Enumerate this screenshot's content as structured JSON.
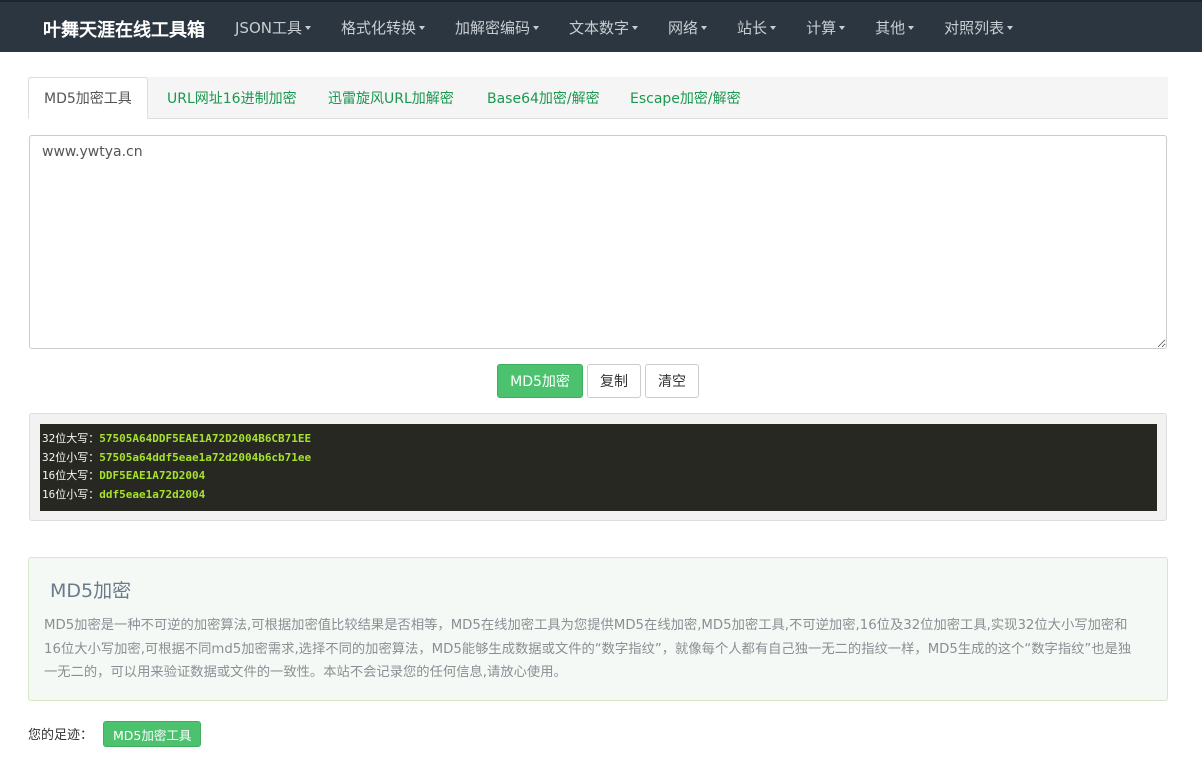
{
  "navbar": {
    "brand": "叶舞天涯在线工具箱",
    "items": [
      {
        "label": "JSON工具"
      },
      {
        "label": "格式化转换"
      },
      {
        "label": "加解密编码"
      },
      {
        "label": "文本数字"
      },
      {
        "label": "网络"
      },
      {
        "label": "站长"
      },
      {
        "label": "计算"
      },
      {
        "label": "其他"
      },
      {
        "label": "对照列表"
      }
    ]
  },
  "tabs": [
    {
      "label": "MD5加密工具",
      "active": true
    },
    {
      "label": "URL网址16进制加密"
    },
    {
      "label": "迅雷旋风URL加解密"
    },
    {
      "label": "Base64加密/解密"
    },
    {
      "label": "Escape加密/解密"
    }
  ],
  "input": {
    "value": "www.ywtya.cn"
  },
  "buttons": {
    "encrypt": "MD5加密",
    "copy": "复制",
    "clear": "清空"
  },
  "results": [
    {
      "label": "32位大写：",
      "value": "57505A64DDF5EAE1A72D2004B6CB71EE"
    },
    {
      "label": "32位小写：",
      "value": "57505a64ddf5eae1a72d2004b6cb71ee"
    },
    {
      "label": "16位大写：",
      "value": "DDF5EAE1A72D2004"
    },
    {
      "label": "16位小写：",
      "value": "ddf5eae1a72d2004"
    }
  ],
  "info": {
    "title": "MD5加密",
    "body": "MD5加密是一种不可逆的加密算法,可根据加密值比较结果是否相等，MD5在线加密工具为您提供MD5在线加密,MD5加密工具,不可逆加密,16位及32位加密工具,实现32位大小写加密和16位大小写加密,可根据不同md5加密需求,选择不同的加密算法，MD5能够生成数据或文件的“数字指纹”，就像每个人都有自己独一无二的指纹一样，MD5生成的这个“数字指纹”也是独一无二的，可以用来验证数据或文件的一致性。本站不会记录您的任何信息,请放心使用。"
  },
  "footprint": {
    "label": "您的足迹：",
    "items": [
      {
        "label": "MD5加密工具"
      }
    ]
  },
  "colors": {
    "navbar": "#2b3640",
    "accent": "#4cc26e",
    "link": "#1a9850",
    "result_bg": "#272822",
    "result_value": "#a6e22e"
  }
}
